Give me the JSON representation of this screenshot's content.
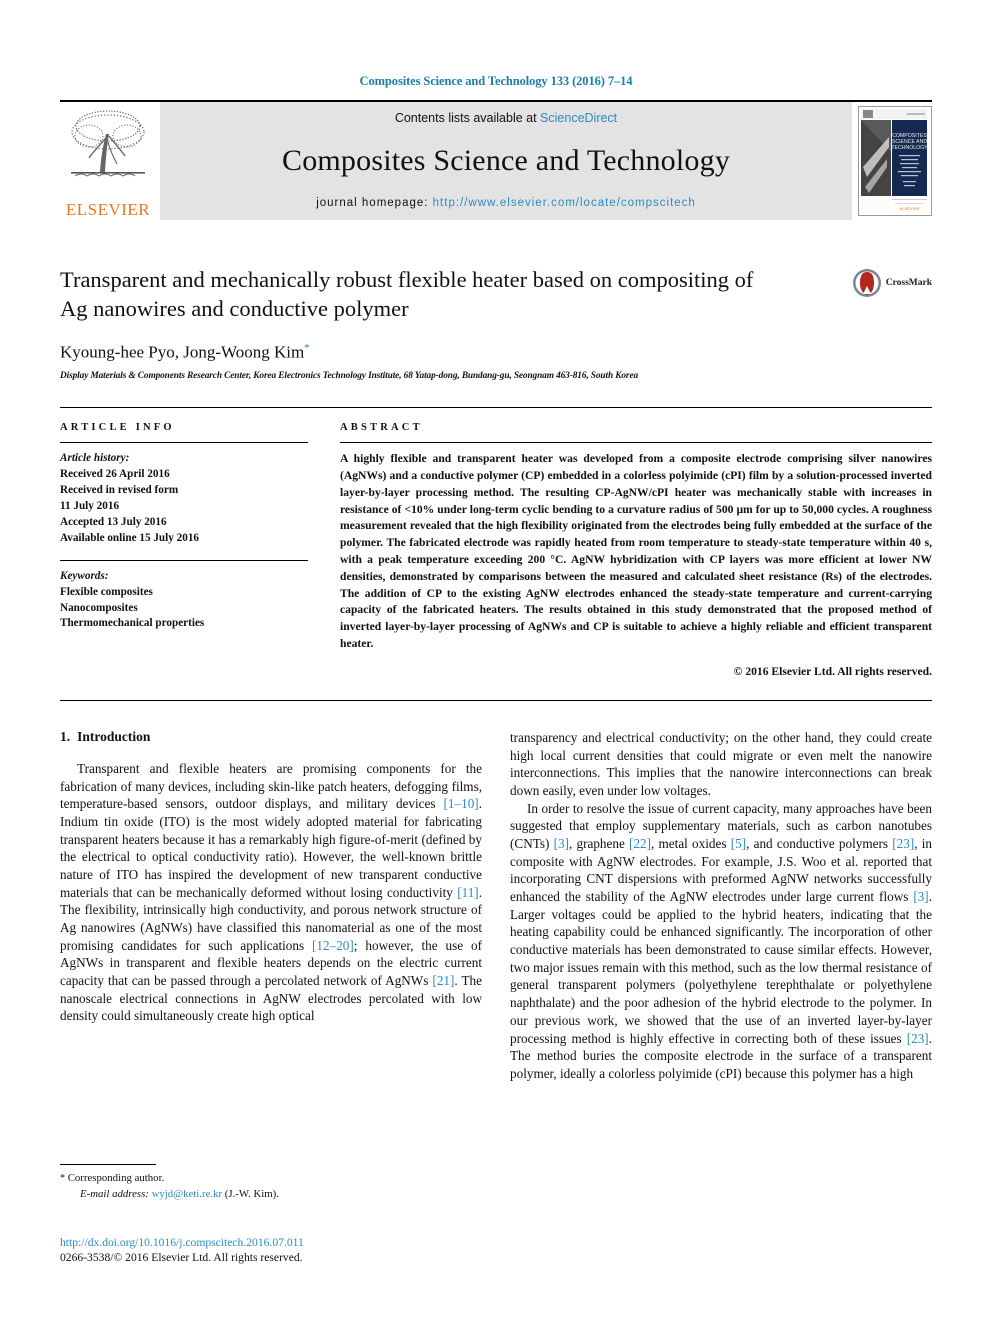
{
  "running_head": "Composites Science and Technology 133 (2016) 7–14",
  "masthead": {
    "publisher_wordmark": "ELSEVIER",
    "contents_prefix": "Contents lists available at ",
    "contents_link": "ScienceDirect",
    "journal_title": "Composites Science and Technology",
    "homepage_label": "journal homepage: ",
    "homepage_url": "http://www.elsevier.com/locate/compscitech",
    "cover_title_lines": [
      "COMPOSITES",
      "SCIENCE AND",
      "TECHNOLOGY"
    ]
  },
  "article": {
    "title": "Transparent and mechanically robust flexible heater based on compositing of Ag nanowires and conductive polymer",
    "authors": "Kyoung-hee Pyo, Jong-Woong Kim",
    "corresponding_marker": "*",
    "affiliation": "Display Materials & Components Research Center, Korea Electronics Technology Institute, 68 Yatap-dong, Bundang-gu, Seongnam 463-816, South Korea",
    "crossmark_label": "CrossMark"
  },
  "info": {
    "heading": "ARTICLE INFO",
    "history_label": "Article history:",
    "history_lines": [
      "Received 26 April 2016",
      "Received in revised form",
      "11 July 2016",
      "Accepted 13 July 2016",
      "Available online 15 July 2016"
    ],
    "keywords_label": "Keywords:",
    "keywords": [
      "Flexible composites",
      "Nanocomposites",
      "Thermomechanical properties"
    ]
  },
  "abstract": {
    "heading": "ABSTRACT",
    "text": "A highly flexible and transparent heater was developed from a composite electrode comprising silver nanowires (AgNWs) and a conductive polymer (CP) embedded in a colorless polyimide (cPI) film by a solution-processed inverted layer-by-layer processing method. The resulting CP-AgNW/cPI heater was mechanically stable with increases in resistance of <10% under long-term cyclic bending to a curvature radius of 500 μm for up to 50,000 cycles. A roughness measurement revealed that the high flexibility originated from the electrodes being fully embedded at the surface of the polymer. The fabricated electrode was rapidly heated from room temperature to steady-state temperature within 40 s, with a peak temperature exceeding 200 °C. AgNW hybridization with CP layers was more efficient at lower NW densities, demonstrated by comparisons between the measured and calculated sheet resistance (Rs) of the electrodes. The addition of CP to the existing AgNW electrodes enhanced the steady-state temperature and current-carrying capacity of the fabricated heaters. The results obtained in this study demonstrated that the proposed method of inverted layer-by-layer processing of AgNWs and CP is suitable to achieve a highly reliable and efficient transparent heater.",
    "copyright": "© 2016 Elsevier Ltd. All rights reserved."
  },
  "section": {
    "number": "1.",
    "title": "Introduction"
  },
  "body": {
    "left_paragraphs": [
      "Transparent and flexible heaters are promising components for the fabrication of many devices, including skin-like patch heaters, defogging films, temperature-based sensors, outdoor displays, and military devices [1–10]. Indium tin oxide (ITO) is the most widely adopted material for fabricating transparent heaters because it has a remarkably high figure-of-merit (defined by the electrical to optical conductivity ratio). However, the well-known brittle nature of ITO has inspired the development of new transparent conductive materials that can be mechanically deformed without losing conductivity [11]. The flexibility, intrinsically high conductivity, and porous network structure of Ag nanowires (AgNWs) have classified this nanomaterial as one of the most promising candidates for such applications [12–20]; however, the use of AgNWs in transparent and flexible heaters depends on the electric current capacity that can be passed through a percolated network of AgNWs [21]. The nanoscale electrical connections in AgNW electrodes percolated with low density could simultaneously create high optical"
    ],
    "right_paragraphs": [
      "transparency and electrical conductivity; on the other hand, they could create high local current densities that could migrate or even melt the nanowire interconnections. This implies that the nanowire interconnections can break down easily, even under low voltages.",
      "In order to resolve the issue of current capacity, many approaches have been suggested that employ supplementary materials, such as carbon nanotubes (CNTs) [3], graphene [22], metal oxides [5], and conductive polymers [23], in composite with AgNW electrodes. For example, J.S. Woo et al. reported that incorporating CNT dispersions with preformed AgNW networks successfully enhanced the stability of the AgNW electrodes under large current flows [3]. Larger voltages could be applied to the hybrid heaters, indicating that the heating capability could be enhanced significantly. The incorporation of other conductive materials has been demonstrated to cause similar effects. However, two major issues remain with this method, such as the low thermal resistance of general transparent polymers (polyethylene terephthalate or polyethylene naphthalate) and the poor adhesion of the hybrid electrode to the polymer. In our previous work, we showed that the use of an inverted layer-by-layer processing method is highly effective in correcting both of these issues [23]. The method buries the composite electrode in the surface of a transparent polymer, ideally a colorless polyimide (cPI) because this polymer has a high"
    ]
  },
  "footnote": {
    "corresponding_star": "*",
    "corresponding_text": "Corresponding author.",
    "email_label": "E-mail address:",
    "email": "wyjd@keti.re.kr",
    "email_owner": "(J.-W. Kim)."
  },
  "footer": {
    "doi": "http://dx.doi.org/10.1016/j.compscitech.2016.07.011",
    "issn_line": "0266-3538/© 2016 Elsevier Ltd. All rights reserved."
  },
  "colors": {
    "link": "#2e8ac0",
    "running_head": "#1a7fa8",
    "elsevier_orange": "#E87722",
    "band_gray": "#e3e3e3"
  }
}
